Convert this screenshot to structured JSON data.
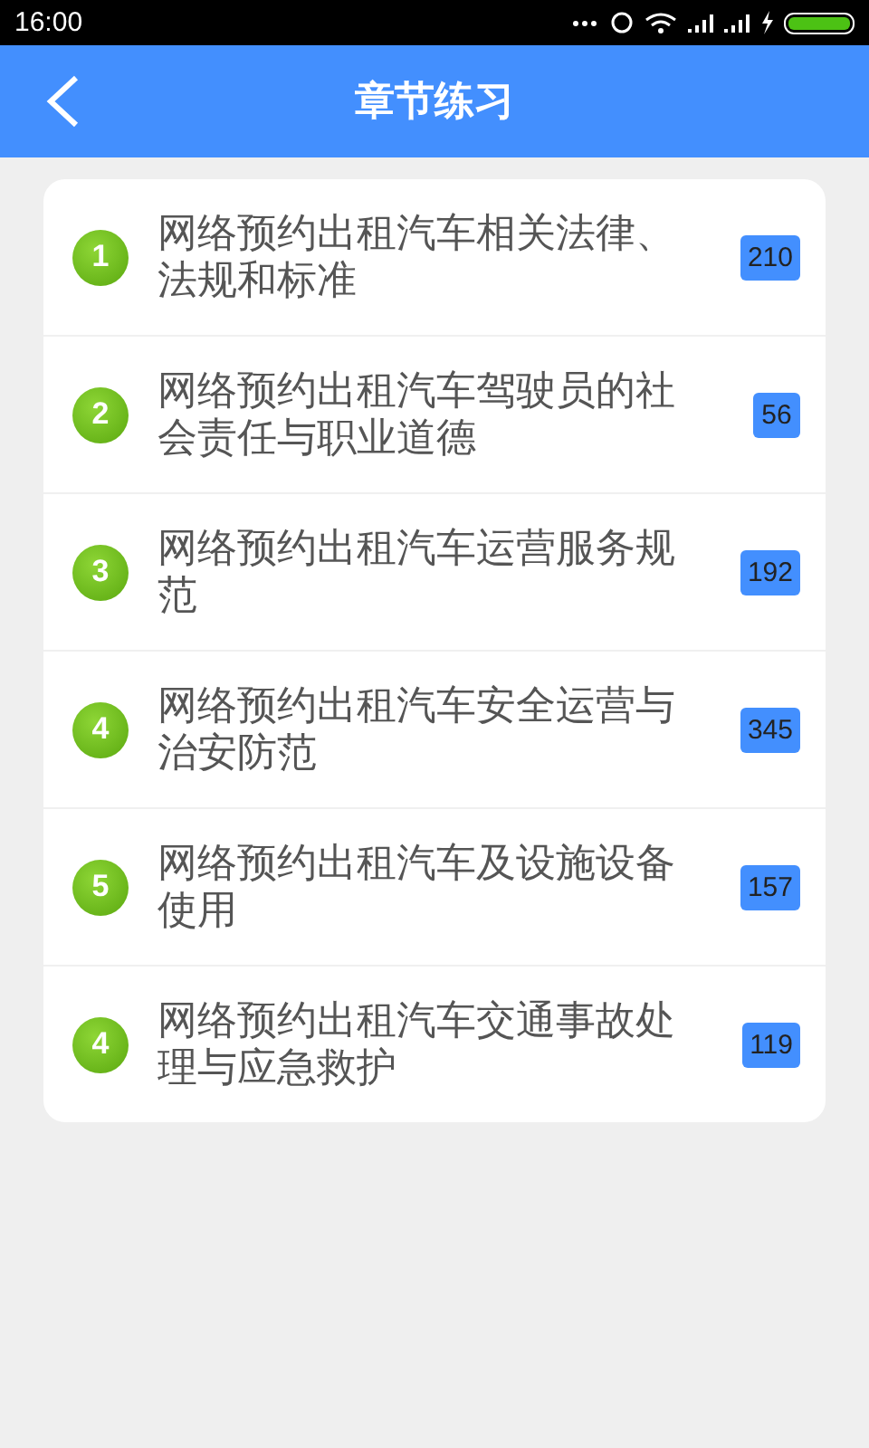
{
  "status_bar": {
    "time": "16:00"
  },
  "header": {
    "title": "章节练习"
  },
  "chapters": [
    {
      "number": "1",
      "title": "网络预约出租汽车相关法律、法规和标准",
      "count": "210"
    },
    {
      "number": "2",
      "title": "网络预约出租汽车驾驶员的社会责任与职业道德",
      "count": "56"
    },
    {
      "number": "3",
      "title": "网络预约出租汽车运营服务规范",
      "count": "192"
    },
    {
      "number": "4",
      "title": "网络预约出租汽车安全运营与治安防范",
      "count": "345"
    },
    {
      "number": "5",
      "title": "网络预约出租汽车及设施设备使用",
      "count": "157"
    },
    {
      "number": "4",
      "title": "网络预约出租汽车交通事故处理与应急救护",
      "count": "119"
    }
  ]
}
